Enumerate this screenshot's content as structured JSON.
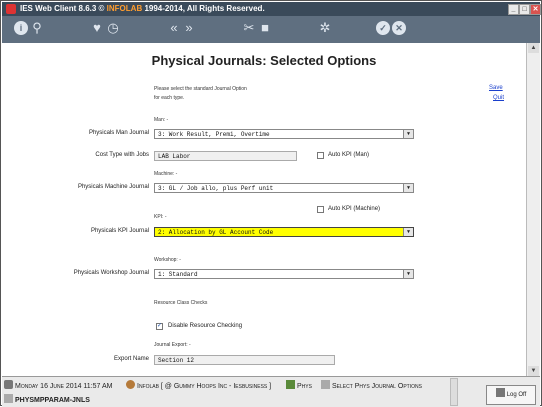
{
  "window": {
    "title_prefix": "IES Web Client 8.6.3 © ",
    "title_brand": "INFOLAB",
    "title_suffix": " 1994-2014, All Rights Reserved.",
    "minimize": "_",
    "maximize": "□",
    "close": "✕"
  },
  "toolbar": {
    "icons": [
      "info-icon",
      "search-icon",
      "favorite-icon",
      "history-icon",
      "back-icon",
      "forward-icon",
      "tools-icon",
      "new-icon",
      "settings-icon",
      "ok-icon",
      "cancel-icon"
    ]
  },
  "page": {
    "title": "Physical Journals: Selected Options",
    "instruction_line1": "Please select the standard Journal Option",
    "instruction_line2": "for each type.",
    "save": "Save",
    "quit": "Quit"
  },
  "man": {
    "section": "Man: -",
    "journal_label": "Physicals Man Journal",
    "journal_value": "3: Work Result, Premi, Overtime",
    "cost_type_label": "Cost Type with Jobs",
    "cost_type_value": "LAB Labor",
    "auto_kpi_label": "Auto KPI (Man)",
    "auto_kpi_checked": false
  },
  "machine": {
    "section": "Machine: -",
    "journal_label": "Physicals Machine Journal",
    "journal_value": "3: GL / Job allo, plus Perf unit",
    "auto_kpi_label": "Auto KPI (Machine)",
    "auto_kpi_checked": false
  },
  "kpi": {
    "section": "KPI: -",
    "journal_label": "Physicals KPI Journal",
    "journal_value": "2: Allocation by GL Account Code",
    "highlight_color": "#ffff00"
  },
  "workshop": {
    "section": "Workshop: -",
    "journal_label": "Physicals Workshop Journal",
    "journal_value": "1: Standard"
  },
  "resource": {
    "section": "Resource Class Checks",
    "disable_label": "Disable Resource Checking",
    "disable_checked": true
  },
  "export": {
    "section": "Journal Export: -",
    "name_label": "Export Name",
    "name_value": "Section 12"
  },
  "status": {
    "date": "Monday 16 June 2014 11:57 AM",
    "user": "Infolab [ @ Gummy Hoops Inc - Iesbusiness ]",
    "module": "Phys",
    "screen": "Select Phys Journal Options",
    "screen_id": "PHYSMPPARAM-JNLS",
    "logoff": "Log Off"
  }
}
